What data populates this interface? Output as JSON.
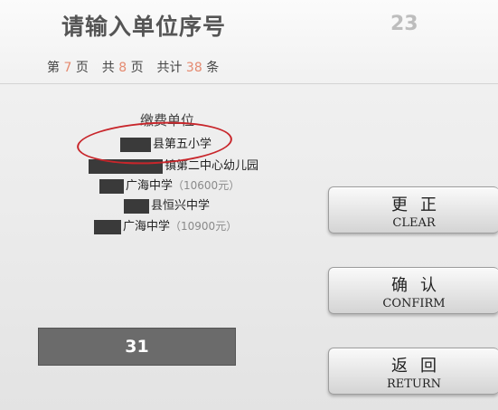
{
  "header": {
    "title": "请输入单位序号",
    "counter": "23"
  },
  "paging": {
    "prefix_page": "第",
    "current_page": "7",
    "suffix_page": "页",
    "prefix_total": "共",
    "total_pages": "8",
    "suffix_total": "页",
    "prefix_count": "共计",
    "total_count": "38",
    "suffix_count": "条"
  },
  "list": {
    "header": "缴费单位",
    "items": [
      {
        "name": "县第五小学",
        "price": ""
      },
      {
        "name": "镇第二中心幼儿园",
        "price": ""
      },
      {
        "name": "广海中学",
        "price": "（10600元）"
      },
      {
        "name": "县恒兴中学",
        "price": ""
      },
      {
        "name": "广海中学",
        "price": "（10900元）"
      }
    ]
  },
  "input": {
    "value": "31"
  },
  "buttons": {
    "clear_zh": "更正",
    "clear_en": "CLEAR",
    "confirm_zh": "确认",
    "confirm_en": "CONFIRM",
    "return_zh": "返回",
    "return_en": "RETURN"
  }
}
